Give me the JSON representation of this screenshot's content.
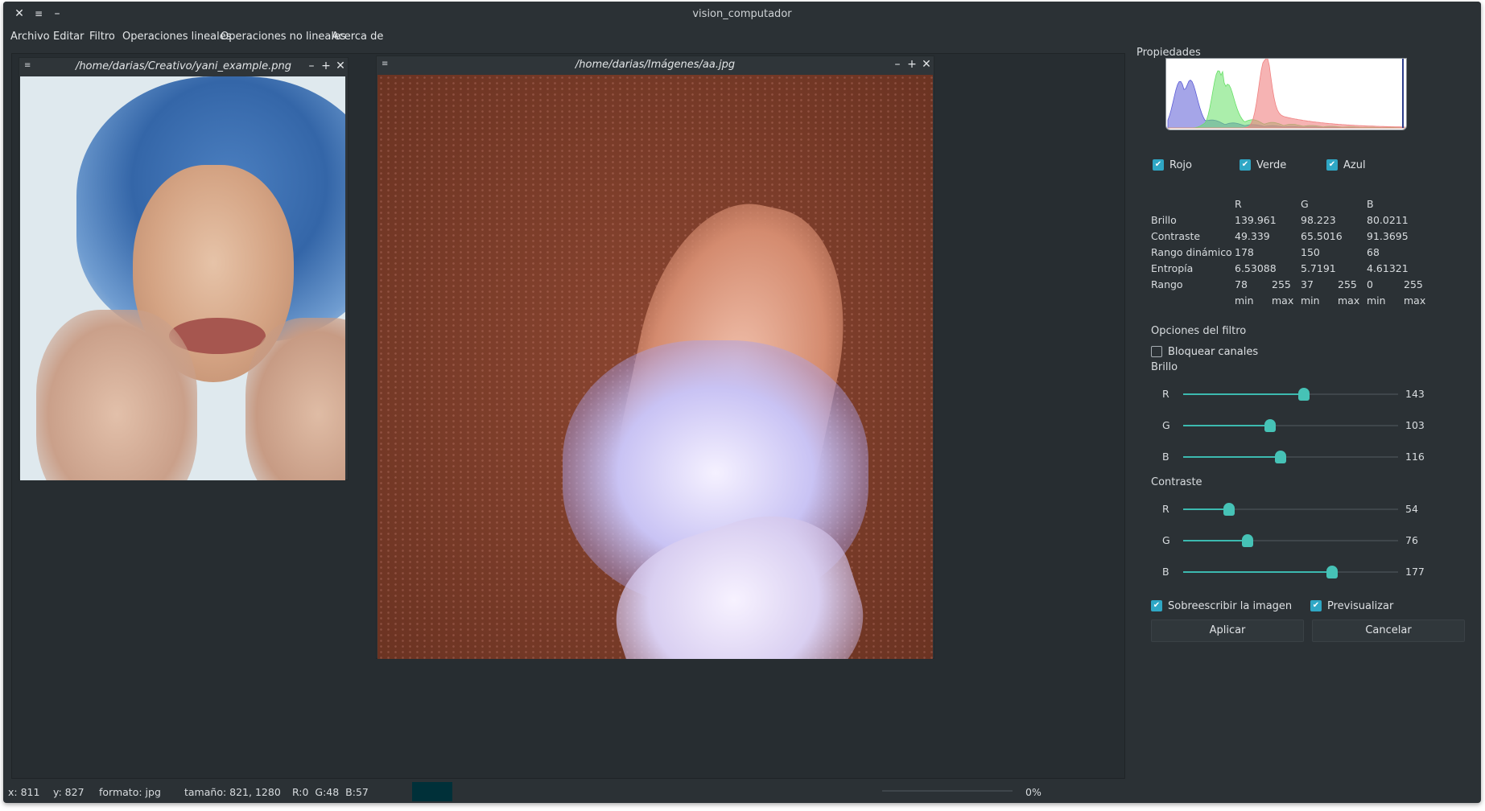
{
  "window": {
    "title": "vision_computador"
  },
  "menu": [
    "Archivo",
    "Editar",
    "Filtro",
    "Operaciones lineales",
    "Operaciones no lineales",
    "Acerca de"
  ],
  "images": [
    {
      "path": "/home/darias/Creativo/yani_example.png"
    },
    {
      "path": "/home/darias/Imágenes/aa.jpg"
    }
  ],
  "properties": {
    "title": "Propiedades",
    "channels": [
      {
        "label": "Rojo",
        "checked": true,
        "color": "#f08080"
      },
      {
        "label": "Verde",
        "checked": true,
        "color": "#66e066"
      },
      {
        "label": "Azul",
        "checked": true,
        "color": "#5b5bd6"
      }
    ],
    "stats": {
      "columns": [
        "R",
        "G",
        "B"
      ],
      "rows": [
        {
          "label": "Brillo",
          "values": [
            "139.961",
            "98.223",
            "80.0211"
          ]
        },
        {
          "label": "Contraste",
          "values": [
            "49.339",
            "65.5016",
            "91.3695"
          ]
        },
        {
          "label": "Rango dinámico",
          "values": [
            "178",
            "150",
            "68"
          ]
        },
        {
          "label": "Entropía",
          "values": [
            "6.53088",
            "5.7191",
            "4.61321"
          ]
        }
      ],
      "range": {
        "label": "Rango",
        "values": [
          "78",
          "255",
          "37",
          "255",
          "0",
          "255"
        ],
        "sublabels": [
          "min",
          "max",
          "min",
          "max",
          "min",
          "max"
        ]
      }
    },
    "filter": {
      "title": "Opciones del filtro",
      "lock_channels": {
        "label": "Bloquear canales",
        "checked": false
      },
      "brightness": {
        "label": "Brillo",
        "max": 255,
        "sliders": [
          {
            "channel": "R",
            "value": 143
          },
          {
            "channel": "G",
            "value": 103
          },
          {
            "channel": "B",
            "value": 116
          }
        ]
      },
      "contrast": {
        "label": "Contraste",
        "max": 255,
        "sliders": [
          {
            "channel": "R",
            "value": 54
          },
          {
            "channel": "G",
            "value": 76
          },
          {
            "channel": "B",
            "value": 177
          }
        ]
      },
      "overwrite": {
        "label": "Sobreescribir la imagen",
        "checked": true
      },
      "preview": {
        "label": "Previsualizar",
        "checked": true
      },
      "apply_label": "Aplicar",
      "cancel_label": "Cancelar"
    }
  },
  "status": {
    "x": "x: 811",
    "y": "y: 827",
    "format": "formato: jpg",
    "size": "tamaño: 821, 1280",
    "rgb": "R:0  G:48  B:57",
    "swatch_color": "#003039",
    "progress_label": "0%",
    "progress_percent": 0
  }
}
